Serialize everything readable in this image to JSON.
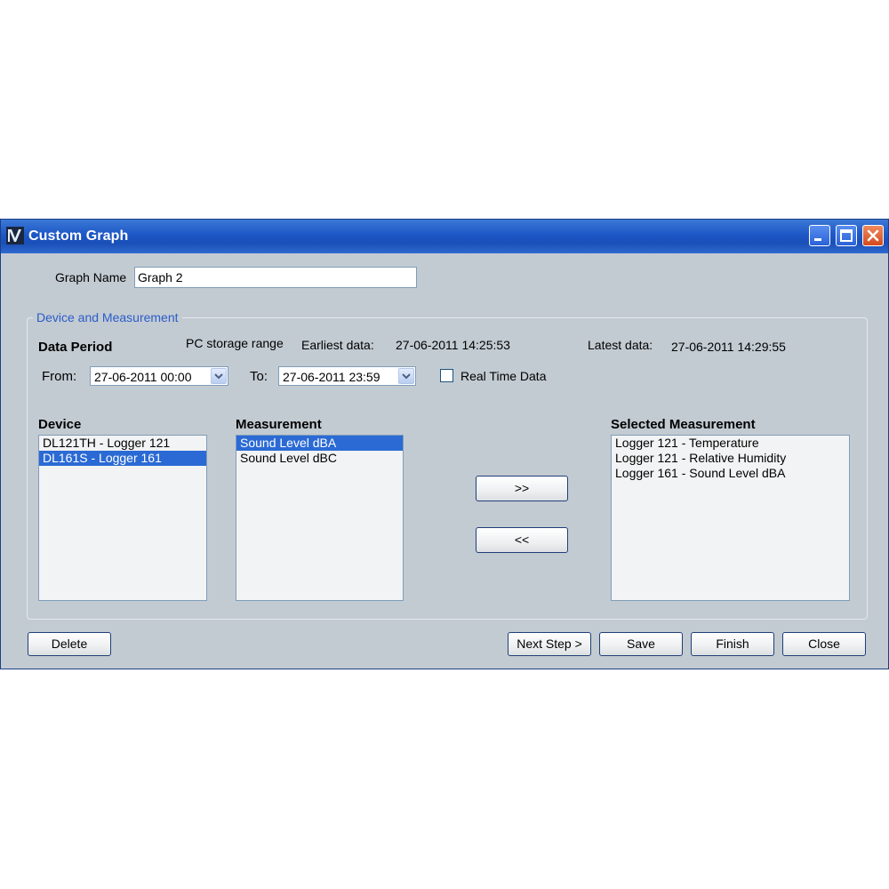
{
  "window": {
    "title": "Custom Graph"
  },
  "graph_name": {
    "label": "Graph Name",
    "value": "Graph 2"
  },
  "device_measurement": {
    "group_title": "Device and Measurement",
    "data_period_label": "Data Period",
    "pc_storage_label": "PC storage range",
    "earliest_label": "Earliest data:",
    "earliest_value": "27-06-2011 14:25:53",
    "latest_label": "Latest data:",
    "latest_value": "27-06-2011 14:29:55",
    "from_label": "From:",
    "from_value": "27-06-2011 00:00",
    "to_label": "To:",
    "to_value": "27-06-2011 23:59",
    "realtime_label": "Real Time Data",
    "realtime_checked": false
  },
  "device": {
    "header": "Device",
    "items": [
      "DL121TH - Logger 121",
      "DL161S - Logger 161"
    ],
    "selected_index": 1
  },
  "measurement": {
    "header": "Measurement",
    "items": [
      "Sound Level dBA",
      "Sound Level dBC"
    ],
    "selected_index": 0
  },
  "selected_measurement": {
    "header": "Selected Measurement",
    "items": [
      "Logger 121 - Temperature",
      "Logger 121 - Relative Humidity",
      "Logger 161 - Sound Level dBA"
    ]
  },
  "transfer": {
    "add_label": ">>",
    "remove_label": "<<"
  },
  "footer": {
    "delete_label": "Delete",
    "next_label": "Next Step >",
    "save_label": "Save",
    "finish_label": "Finish",
    "close_label": "Close"
  },
  "colors": {
    "titlebar": "#1d57c6",
    "window_bg": "#c3cbd2",
    "selection": "#2b6ad4",
    "group_title": "#2b5cc9"
  }
}
